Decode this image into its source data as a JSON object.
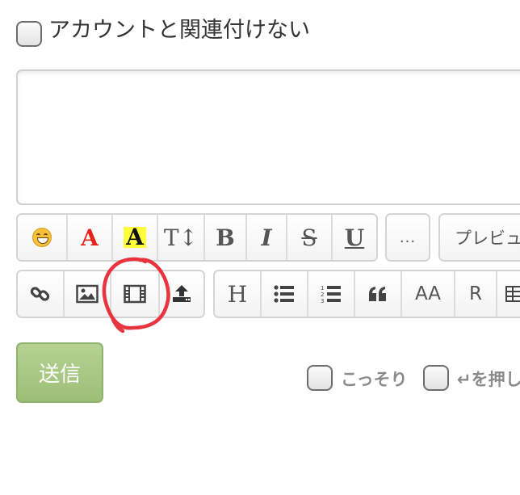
{
  "anonymous": {
    "label": "アカウントと関連付けない",
    "checked": false
  },
  "comment": {
    "value": "",
    "placeholder": ""
  },
  "toolbar": {
    "row1": [
      {
        "name": "emoji-button",
        "icon": "smile-emoji-icon"
      },
      {
        "name": "font-color-button",
        "text": "A"
      },
      {
        "name": "highlight-button",
        "text": "A"
      },
      {
        "name": "font-size-button",
        "text": "T↕"
      },
      {
        "name": "bold-button",
        "text": "B"
      },
      {
        "name": "italic-button",
        "text": "I"
      },
      {
        "name": "strikethrough-button",
        "text": "S"
      },
      {
        "name": "underline-button",
        "text": "U"
      }
    ],
    "more_label": "...",
    "preview_label": "プレビュ",
    "row2": [
      {
        "name": "link-button",
        "icon": "link-icon"
      },
      {
        "name": "image-button",
        "icon": "image-icon"
      },
      {
        "name": "video-button",
        "icon": "film-icon"
      },
      {
        "name": "upload-button",
        "icon": "upload-icon"
      }
    ],
    "row2b": [
      {
        "name": "heading-button",
        "text": "H"
      },
      {
        "name": "bullet-list-button",
        "icon": "bullet-list-icon"
      },
      {
        "name": "numbered-list-button",
        "icon": "numbered-list-icon"
      },
      {
        "name": "quote-button",
        "icon": "quote-icon"
      },
      {
        "name": "text-size-button",
        "text": "AA"
      },
      {
        "name": "r-button",
        "text": "R"
      },
      {
        "name": "table-button",
        "icon": "table-icon"
      }
    ]
  },
  "submit_label": "送信",
  "options": [
    {
      "label": "こっそり",
      "checked": false
    },
    {
      "label": "↵を押し",
      "checked": false
    }
  ],
  "colors": {
    "font_color_red": "#e3231c",
    "highlight_yellow": "#ffff3a",
    "submit_green": "#a7c784",
    "annotation_red": "#e8343f"
  }
}
